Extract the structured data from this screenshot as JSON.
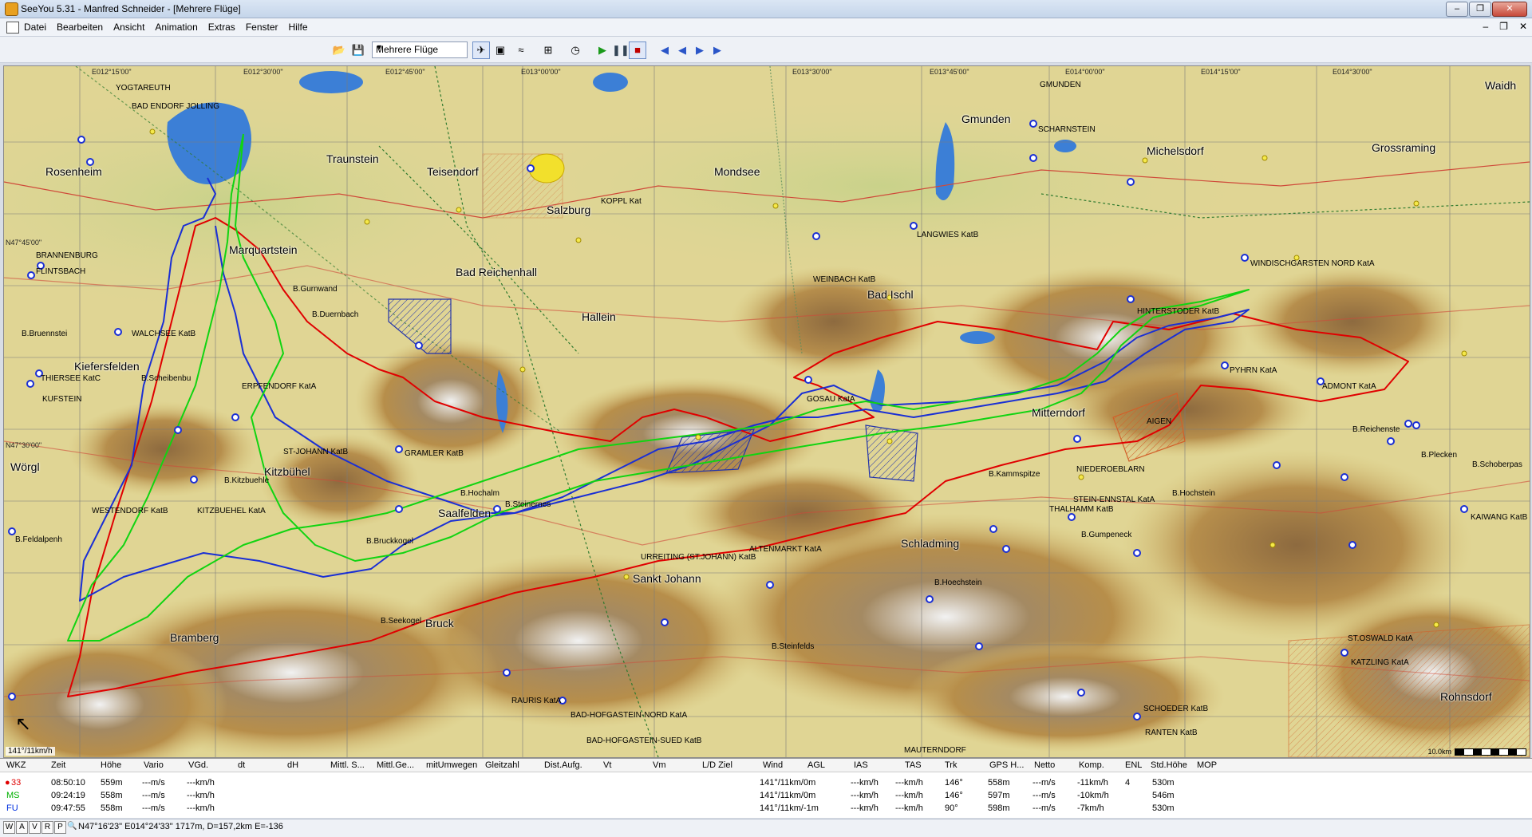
{
  "window": {
    "title": "SeeYou 5.31 - Manfred Schneider - [Mehrere Flüge]"
  },
  "menu": [
    "Datei",
    "Bearbeiten",
    "Ansicht",
    "Animation",
    "Extras",
    "Fenster",
    "Hilfe"
  ],
  "toolbar": {
    "flight_select_value": "Mehrere Flüge"
  },
  "map": {
    "top_coords": [
      "E012°15'00\"",
      "E012°30'00\"",
      "E012°45'00\"",
      "E013°00'00\"",
      "E013°30'00\"",
      "E013°45'00\"",
      "E014°00'00\"",
      "E014°15'00\"",
      "E014°30'00\""
    ],
    "left_coords": [
      "N47°45'00\"",
      "N47°30'00\""
    ],
    "towns": [
      "Rosenheim",
      "Traunstein",
      "Teisendorf",
      "Salzburg",
      "Mondsee",
      "Gmunden",
      "Grossraming",
      "Marquartstein",
      "Bad Reichenhall",
      "Bad Ischl",
      "Hallein",
      "Kiefersfelden",
      "Kitzbühel",
      "Saalfelden",
      "Schladming",
      "Sankt Johann",
      "Mitterndorf",
      "Bramberg",
      "Bruck",
      "Wörgl",
      "Michelsdorf",
      "Rohnsdorf",
      "Waidh"
    ],
    "labels": [
      "YOGTAREUTH",
      "BAD ENDORF JOLLING",
      "BRANNENBURG",
      "FLINTSBACH",
      "WALCHSEE KatB",
      "KUFSTEIN",
      "THIERSEE KatC",
      "ERPFENDORF KatA",
      "KITZBUEHEL KatA",
      "WESTENDORF KatB",
      "ST-JOHANN KatB",
      "GRAMLER KatB",
      "GOSAU KatA",
      "WEINBACH KatB",
      "LANGWIES KatB",
      "SCHARNSTEIN",
      "GMUNDEN",
      "KOPPL Kat",
      "WINDISCHGARSTEN NORD KatA",
      "HINTERSTODER KatB",
      "PYHRN KatA",
      "ADMONT KatA",
      "AIGEN",
      "NIEDEROEBLARN",
      "STEIN-ENNSTAL KatA",
      "THALHAMM KatB",
      "ALTENMARKT KatA",
      "URREITING (ST.JOHANN) KatB",
      "BAD-HOFGASTEIN-NORD KatA",
      "BAD-HOFGASTEIN-SUED KatB",
      "RAURIS KatA",
      "SCHOEDER KatB",
      "RANTEN KatB",
      "KATZLING KatA",
      "ST.OSWALD KatA",
      "KAIWANG KatB",
      "MAUTERNDORF",
      "B.Steinernes",
      "B.Hochstein",
      "B.Kammspitze",
      "B.Bruckkogel",
      "B.Gumpeneck",
      "B.Seekogel",
      "B.Hoechstein",
      "B.Steinfelds",
      "B.Feldalpenh",
      "B.Kitzbuehle",
      "B.Gurnwand",
      "B.Duernbach",
      "B.Bruennstei",
      "B.Scheibenbu",
      "B.Hochalm",
      "B.Reichenste",
      "B.Plecken",
      "B.Schoberpas"
    ],
    "position_readout": "141°/11km/h",
    "scale_label": "10.0km"
  },
  "table": {
    "headers": [
      "WKZ",
      "Zeit",
      "Höhe",
      "Vario",
      "VGd.",
      "dt",
      "dH",
      "Mittl. S...",
      "Mittl.Ge...",
      "mitUmwegen",
      "Gleitzahl",
      "Dist.Aufg.",
      "Vt",
      "Vm",
      "L/D Ziel",
      "Wind",
      "AGL",
      "IAS",
      "TAS",
      "Trk",
      "GPS H...",
      "Netto",
      "Komp.",
      "ENL",
      "Std.Höhe",
      "MOP"
    ],
    "rows": [
      {
        "wkz": "33",
        "color": "#e00000",
        "zeit": "08:50:10",
        "hoehe": "559m",
        "vario": "---m/s",
        "vgd": "---km/h",
        "wind": "141°/11km/0m",
        "agl": "---km/h",
        "ias": "---km/h",
        "tas": "---km/h",
        "trk": "146°",
        "gps": "558m",
        "netto": "---m/s",
        "komp": "-11km/h",
        "enl": "4",
        "std": "530m"
      },
      {
        "wkz": "MS",
        "color": "#00b000",
        "zeit": "09:24:19",
        "hoehe": "558m",
        "vario": "---m/s",
        "vgd": "---km/h",
        "wind": "141°/11km/0m",
        "agl": "---km/h",
        "ias": "---km/h",
        "tas": "---km/h",
        "trk": "146°",
        "gps": "597m",
        "netto": "---m/s",
        "komp": "-10km/h",
        "enl": "",
        "std": "546m"
      },
      {
        "wkz": "FU",
        "color": "#0030e0",
        "zeit": "09:47:55",
        "hoehe": "558m",
        "vario": "---m/s",
        "vgd": "---km/h",
        "wind": "141°/11km/-1m",
        "agl": "---km/h",
        "ias": "---km/h",
        "tas": "---km/h",
        "trk": "90°",
        "gps": "598m",
        "netto": "---m/s",
        "komp": "-7km/h",
        "enl": "",
        "std": "530m"
      }
    ]
  },
  "status": {
    "buttons": [
      "W",
      "A",
      "V",
      "R",
      "P"
    ],
    "text": "N47°16'23\"  E014°24'33\"  1717m, D=157,2km E=-136"
  },
  "colors": {
    "track_red": "#e00000",
    "track_green": "#11d411",
    "track_blue": "#1a2fd4"
  }
}
